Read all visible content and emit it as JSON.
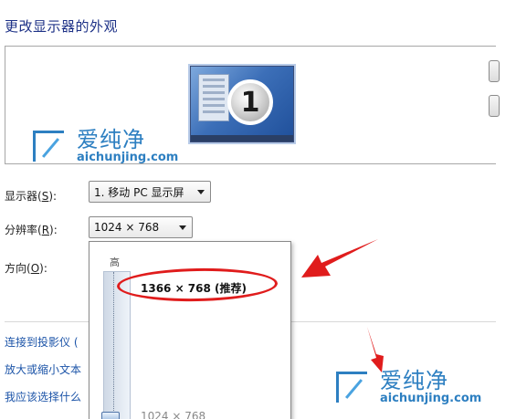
{
  "page": {
    "title": "更改显示器的外观"
  },
  "preview": {
    "monitor_number": "1"
  },
  "display_row": {
    "label_prefix": "显示器(",
    "label_key": "S",
    "label_suffix": "):",
    "value": "1. 移动 PC 显示屏"
  },
  "resolution_row": {
    "label_prefix": "分辨率(",
    "label_key": "R",
    "label_suffix": "):",
    "value": "1024 × 768"
  },
  "orientation_row": {
    "label_prefix": "方向(",
    "label_key": "O",
    "label_suffix": "):"
  },
  "resolution_dropdown": {
    "high_label": "高",
    "options": [
      {
        "label": "1366 × 768 (推荐)",
        "highlighted": true
      },
      {
        "label": "1024 × 768",
        "highlighted": false
      }
    ]
  },
  "links": [
    "连接到投影仪 (",
    "放大或缩小文本",
    "我应该选择什么"
  ],
  "watermark": {
    "cn": "爱纯净",
    "en": "aichunjing.com"
  },
  "annotation_color": "#e01c1c",
  "accent_color": "#1e3287"
}
